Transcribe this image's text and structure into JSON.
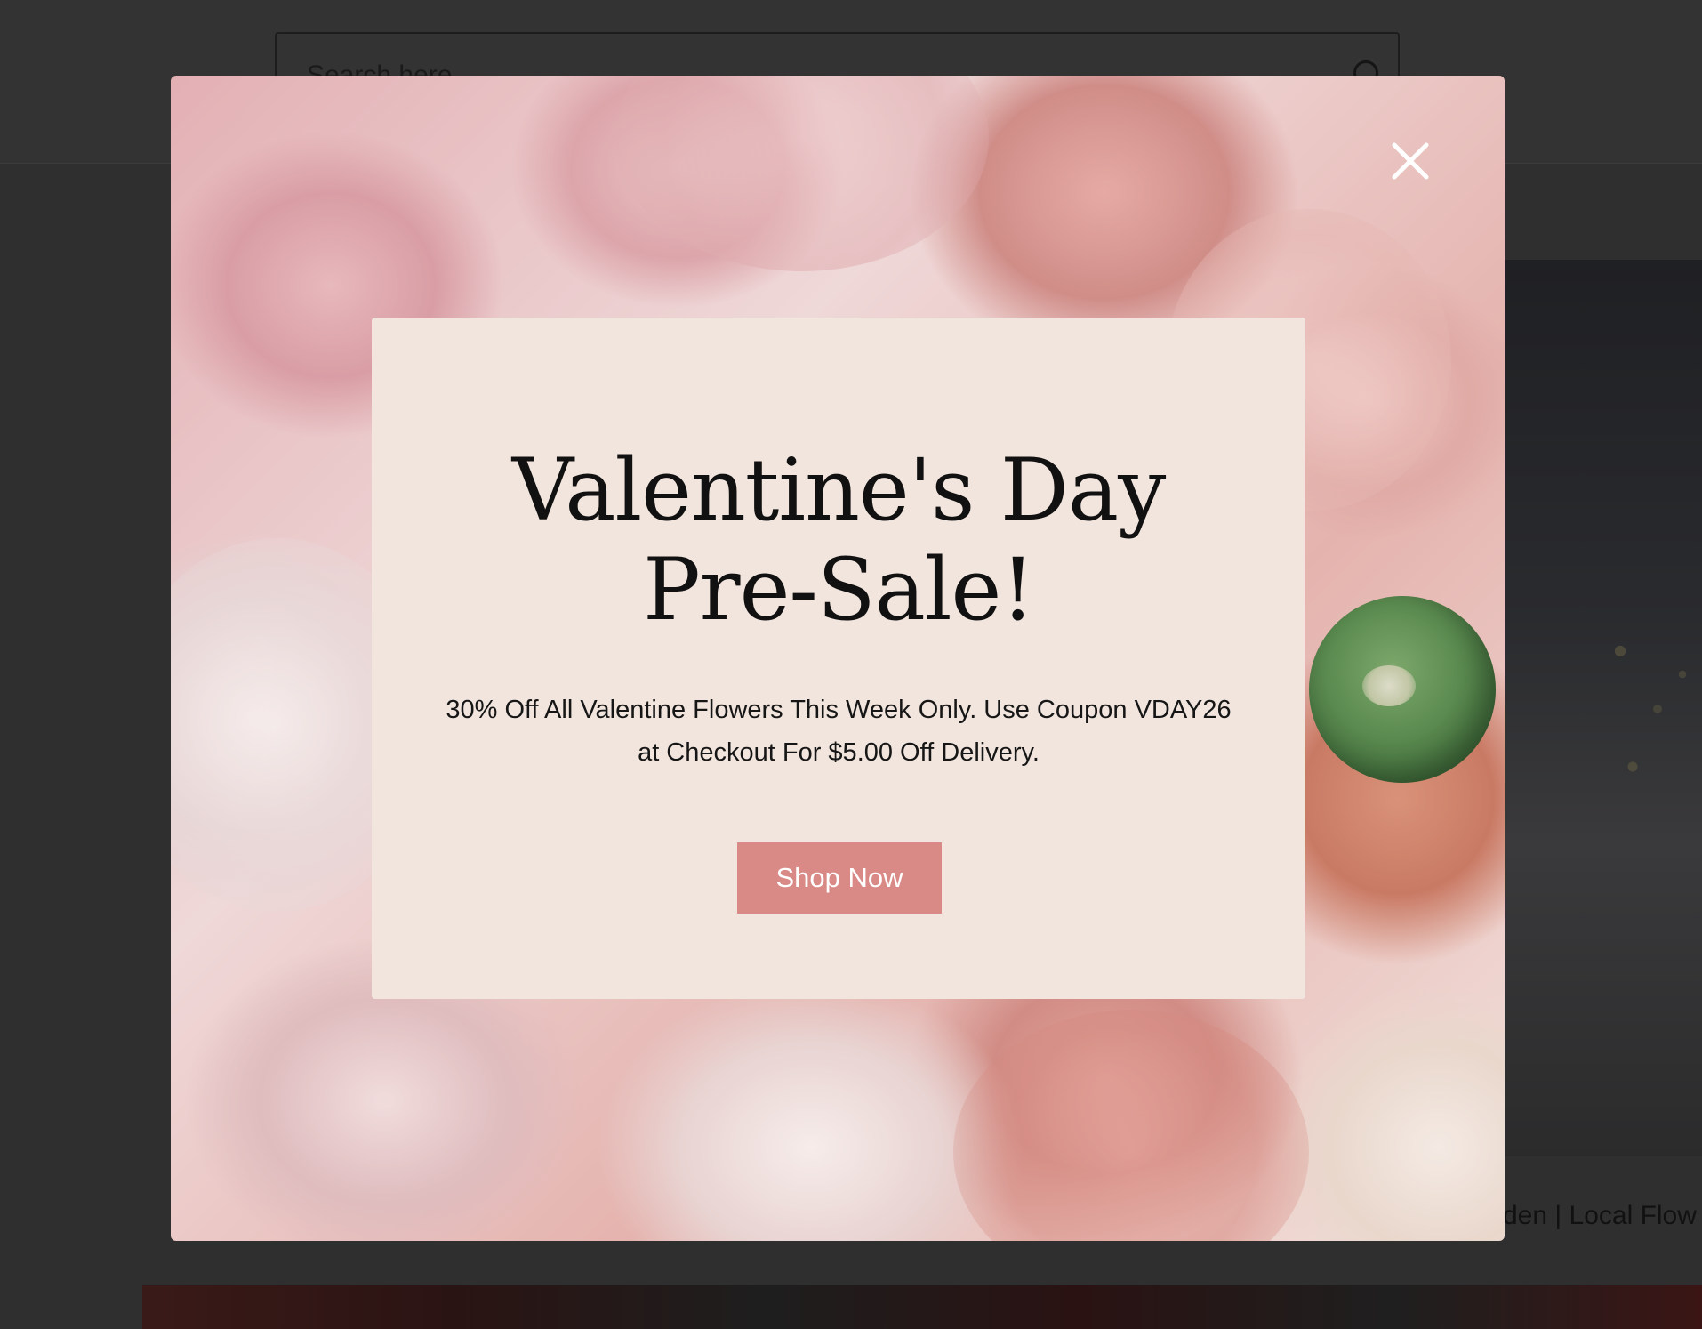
{
  "background_page": {
    "search": {
      "placeholder": "Search here"
    },
    "footer_text": "den | Local Flow"
  },
  "popup": {
    "title": "Valentine's Day Pre-Sale!",
    "body": "30% Off All Valentine Flowers This Week Only. Use Coupon VDAY26 at Checkout For $5.00 Off Delivery.",
    "cta_label": "Shop Now",
    "close_icon": "close-icon",
    "colors": {
      "card_background": "#f2e5de",
      "cta_background": "#d98a86",
      "cta_text": "#ffffff",
      "title_text": "#111111"
    }
  }
}
